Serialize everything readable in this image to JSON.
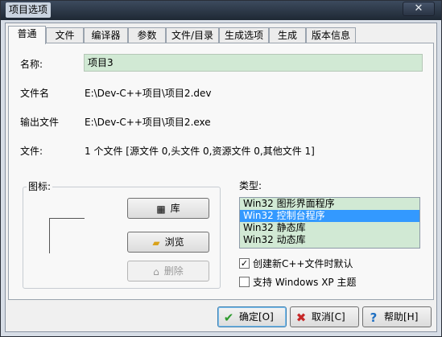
{
  "window": {
    "title": "项目选项",
    "close_label": "✕"
  },
  "tabs": [
    {
      "label": "普通",
      "active": true
    },
    {
      "label": "文件"
    },
    {
      "label": "编译器"
    },
    {
      "label": "参数"
    },
    {
      "label": "文件/目录"
    },
    {
      "label": "生成选项"
    },
    {
      "label": "生成"
    },
    {
      "label": "版本信息"
    }
  ],
  "general": {
    "name_label": "名称:",
    "name_value": "项目3",
    "filename_label": "文件名",
    "filename_value": "E:\\Dev-C++项目\\项目2.dev",
    "output_label": "输出文件",
    "output_value": "E:\\Dev-C++项目\\项目2.exe",
    "files_label": "文件:",
    "files_value": "1 个文件 [源文件 0,头文件 0,资源文件 0,其他文件 1]"
  },
  "icon_group": {
    "label": "图标:",
    "library_button": "库",
    "browse_button": "浏览",
    "delete_button": "删除"
  },
  "type_group": {
    "label": "类型:",
    "options": [
      "Win32 图形界面程序",
      "Win32 控制台程序",
      "Win32 静态库",
      "Win32 动态库"
    ],
    "selected_index": 1
  },
  "checkboxes": {
    "create_default_cpp": {
      "label": "创建新C++文件时默认",
      "checked": true
    },
    "winxp_theme": {
      "label": "支持 Windows XP 主题",
      "checked": false
    }
  },
  "buttons": {
    "ok": "确定[O]",
    "cancel": "取消[C]",
    "help": "帮助[H]"
  },
  "colors": {
    "input_bg": "#d1e9d4",
    "selection": "#3399ff",
    "ok_icon": "#2e9b2e",
    "cancel_icon": "#c62828",
    "help_icon": "#1e6fc2"
  }
}
